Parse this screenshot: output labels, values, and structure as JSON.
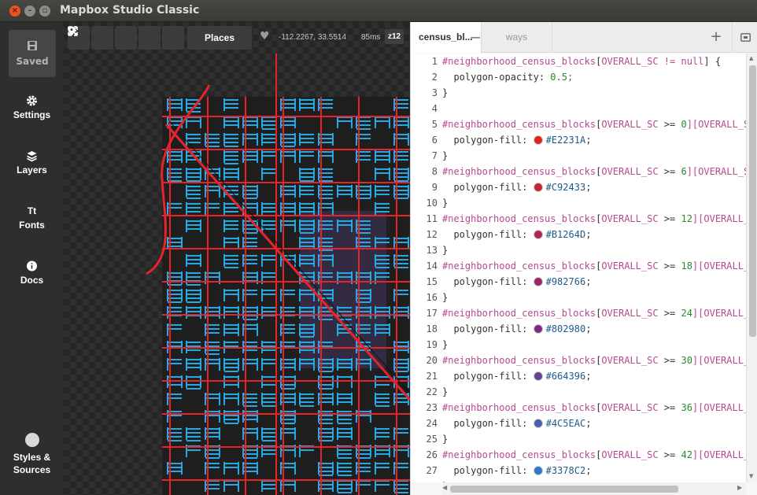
{
  "window": {
    "title": "Mapbox Studio Classic"
  },
  "sidebar": {
    "saved_label": "Saved",
    "items": [
      {
        "label": "Settings",
        "icon": "gear-icon"
      },
      {
        "label": "Layers",
        "icon": "layers-icon"
      },
      {
        "label": "Fonts",
        "icon": "fonts-icon",
        "glyph": "Tt"
      },
      {
        "label": "Docs",
        "icon": "info-icon"
      }
    ],
    "styles_sources": {
      "line1": "Styles &",
      "line2": "Sources"
    }
  },
  "map": {
    "places_label": "Places",
    "coords": "-112.2267, 33.5514",
    "render_time": "85ms",
    "zoom": "z12",
    "colors": {
      "roads": "#e8232a",
      "ways": "#28a8e0",
      "background": "#2d2d2d"
    }
  },
  "editor": {
    "tabs": [
      {
        "label": "census_bl..."
      },
      {
        "label": "ways"
      }
    ],
    "line_numbers": [
      "1",
      "2",
      "3",
      "4",
      "5",
      "6",
      "7",
      "8",
      "9",
      "10",
      "11",
      "12",
      "13",
      "14",
      "15",
      "16",
      "17",
      "18",
      "19",
      "20",
      "21",
      "22",
      "23",
      "24",
      "25",
      "26",
      "27",
      "28"
    ],
    "selector": "#neighborhood_census_blocks",
    "field": "OVERALL_SC",
    "rule1": {
      "op": "!= null",
      "prop": "polygon-opacity:",
      "value": "0.5;"
    },
    "fill_prop": "polygon-fill:",
    "rules": [
      {
        "threshold": "0",
        "trail": "][OVERALL_S",
        "color": "#E2231A"
      },
      {
        "threshold": "6",
        "trail": "][OVERALL_S",
        "color": "#C92433"
      },
      {
        "threshold": "12",
        "trail": "][OVERALL_",
        "color": "#B1264D"
      },
      {
        "threshold": "18",
        "trail": "][OVERALL_",
        "color": "#982766"
      },
      {
        "threshold": "24",
        "trail": "][OVERALL_",
        "color": "#802980"
      },
      {
        "threshold": "30",
        "trail": "][OVERALL_",
        "color": "#664396"
      },
      {
        "threshold": "36",
        "trail": "][OVERALL_",
        "color": "#4C5EAC"
      },
      {
        "threshold": "42",
        "trail": "][OVERALL_",
        "color": "#3378C2"
      }
    ]
  }
}
